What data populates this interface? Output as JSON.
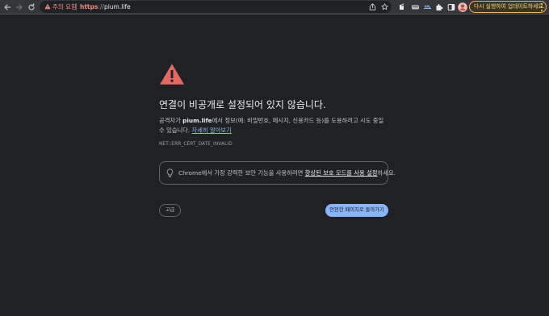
{
  "toolbar": {
    "security_label": "주의 요함",
    "url_scheme": "https",
    "url_separator": "://",
    "url_host": "pium.life",
    "update_label": "다시 실행하여 업데이트하세요."
  },
  "icons": {
    "back": "back-arrow-icon",
    "forward": "forward-arrow-icon",
    "reload": "reload-icon",
    "warning": "warning-triangle-icon",
    "share": "share-icon",
    "bookmark": "star-icon",
    "extensions": [
      "extension-1-icon",
      "extension-2-icon",
      "extension-3-icon",
      "puzzle-icon"
    ],
    "side_panel": "side-panel-icon",
    "profile": "avatar",
    "menu": "kebab-menu-icon",
    "lightbulb": "lightbulb-icon",
    "alert": "red-alert-triangle-icon"
  },
  "interstitial": {
    "heading": "연결이 비공개로 설정되어 있지 않습니다.",
    "paragraph_prefix": "공격자가 ",
    "paragraph_host": "pium.life",
    "paragraph_suffix": "에서 정보(예: 비밀번호, 메시지, 신용카드 등)를 도용하려고 시도 중일 수 있습니다. ",
    "learn_more": "자세히 알아보기",
    "error_code": "NET::ERR_CERT_DATE_INVALID",
    "tip_prefix": "Chrome에서 가장 강력한 보안 기능을 사용하려면 ",
    "tip_link": "향상된 보호 모드를 사용 설정",
    "tip_suffix": "하세요.",
    "advanced_button": "고급",
    "back_button": "안전한 페이지로 돌아가기"
  },
  "colors": {
    "page_background": "#202124",
    "toolbar_background": "#35363a",
    "warning_red": "#f28b82",
    "alert_red": "#e46962",
    "link_blue": "#8ab4f8",
    "update_yellow": "#fdd663"
  }
}
